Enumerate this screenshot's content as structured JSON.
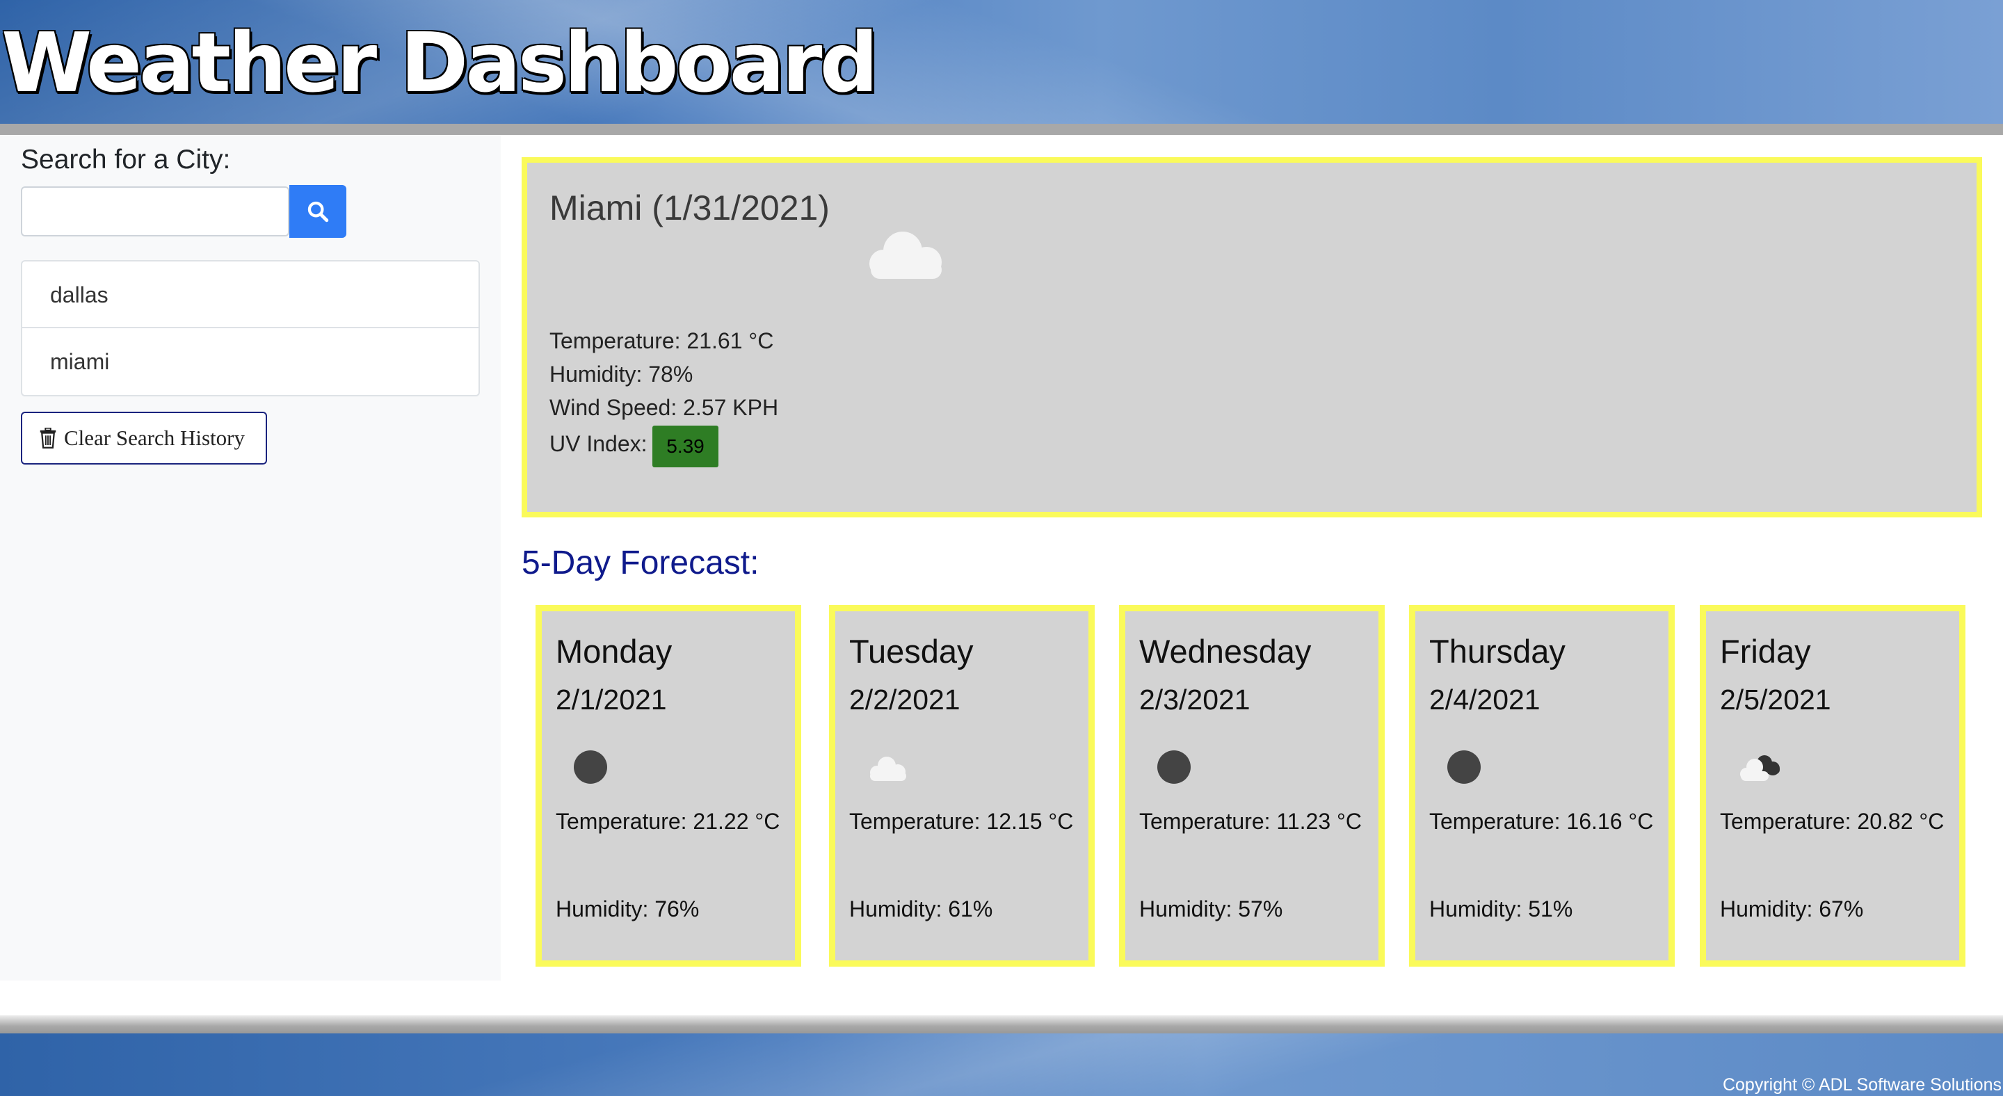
{
  "header": {
    "title": "Weather Dashboard"
  },
  "sidebar": {
    "search_label": "Search for a City:",
    "search_value": "",
    "search_button_icon": "search-icon",
    "history": [
      {
        "label": "dallas"
      },
      {
        "label": "miami"
      }
    ],
    "clear_label": "Clear Search History",
    "clear_icon": "trash-icon"
  },
  "current": {
    "title": "Miami (1/31/2021)",
    "icon": "cloud-icon",
    "temperature": "Temperature: 21.61 °C",
    "humidity": "Humidity: 78%",
    "wind": "Wind Speed: 2.57 KPH",
    "uv_label": "UV Index:",
    "uv_value": "5.39",
    "uv_color": "#2e7d24"
  },
  "forecast": {
    "title": "5-Day Forecast:",
    "days": [
      {
        "day": "Monday",
        "date": "2/1/2021",
        "icon": "moon-icon",
        "temperature": "Temperature: 21.22 °C",
        "humidity": "Humidity: 76%"
      },
      {
        "day": "Tuesday",
        "date": "2/2/2021",
        "icon": "cloud-icon",
        "temperature": "Temperature: 12.15 °C",
        "humidity": "Humidity: 61%"
      },
      {
        "day": "Wednesday",
        "date": "2/3/2021",
        "icon": "moon-icon",
        "temperature": "Temperature: 11.23 °C",
        "humidity": "Humidity: 57%"
      },
      {
        "day": "Thursday",
        "date": "2/4/2021",
        "icon": "moon-icon",
        "temperature": "Temperature: 16.16 °C",
        "humidity": "Humidity: 51%"
      },
      {
        "day": "Friday",
        "date": "2/5/2021",
        "icon": "broken-clouds-icon",
        "temperature": "Temperature: 20.82 °C",
        "humidity": "Humidity: 67%"
      }
    ]
  },
  "footer": {
    "copyright": "Copyright © ADL Software Solutions"
  },
  "colors": {
    "accent": "#2f7cf6",
    "card_border": "#fafa5a",
    "card_bg": "#d3d3d3",
    "forecast_title": "#0f1a8c"
  }
}
